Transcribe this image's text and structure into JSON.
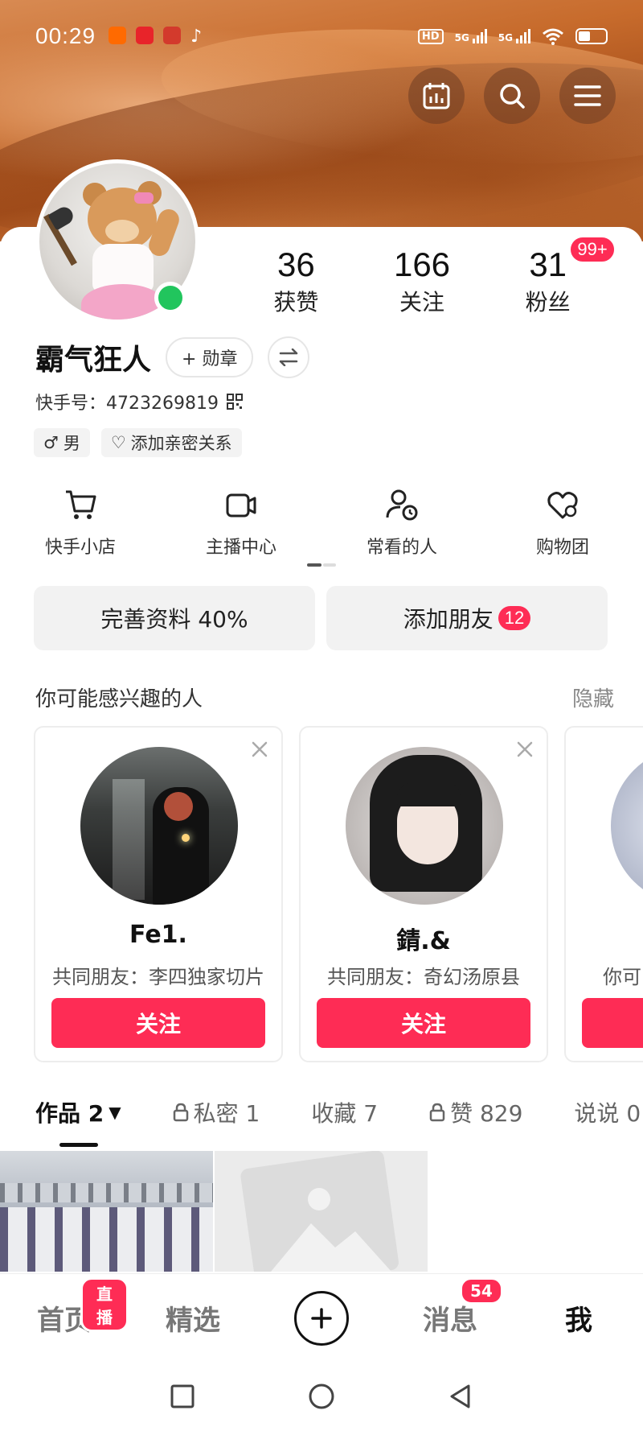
{
  "status_bar": {
    "time": "00:29",
    "hd_label": "HD",
    "net1": "5G",
    "net2": "5G",
    "app_icon_colors": [
      "#ff6a00",
      "#e8242a",
      "#d33a2c",
      "#ffffff"
    ]
  },
  "top_actions": [
    "calendar-icon",
    "search-icon",
    "menu-icon"
  ],
  "profile": {
    "stats": [
      {
        "value": "36",
        "label": "获赞"
      },
      {
        "value": "166",
        "label": "关注"
      },
      {
        "value": "31",
        "label": "粉丝",
        "badge": "99+"
      }
    ],
    "name": "霸气狂人",
    "badge_button": "+ 勋章",
    "user_id": "快手号：4723269819",
    "gender_tag": "男",
    "relation_tag": "添加亲密关系"
  },
  "shortcuts": [
    {
      "label": "快手小店",
      "icon": "cart-icon"
    },
    {
      "label": "主播中心",
      "icon": "camera-icon"
    },
    {
      "label": "常看的人",
      "icon": "user-clock-icon"
    },
    {
      "label": "购物团",
      "icon": "heart-icon"
    }
  ],
  "actions": {
    "complete_profile": "完善资料 40%",
    "add_friends": "添加朋友",
    "add_friends_count": "12"
  },
  "suggestions": {
    "title": "你可能感兴趣的人",
    "hide": "隐藏",
    "cards": [
      {
        "name": "Fe1.",
        "mutual": "共同朋友：李四独家切片",
        "follow": "关注"
      },
      {
        "name": "錆.&",
        "mutual": "共同朋友：奇幻汤原县",
        "follow": "关注"
      },
      {
        "name": "",
        "mutual": "你可",
        "follow": ""
      }
    ]
  },
  "tabs": [
    {
      "label": "作品 2",
      "active": true
    },
    {
      "label": "私密 1"
    },
    {
      "label": "收藏 7"
    },
    {
      "label": "赞 829"
    },
    {
      "label": "说说 0"
    }
  ],
  "bottom_nav": {
    "home": "首页",
    "home_badge": "直播",
    "featured": "精选",
    "messages": "消息",
    "messages_badge": "54",
    "me": "我"
  },
  "colors": {
    "accent": "#fe2c55",
    "online": "#21c55d"
  }
}
